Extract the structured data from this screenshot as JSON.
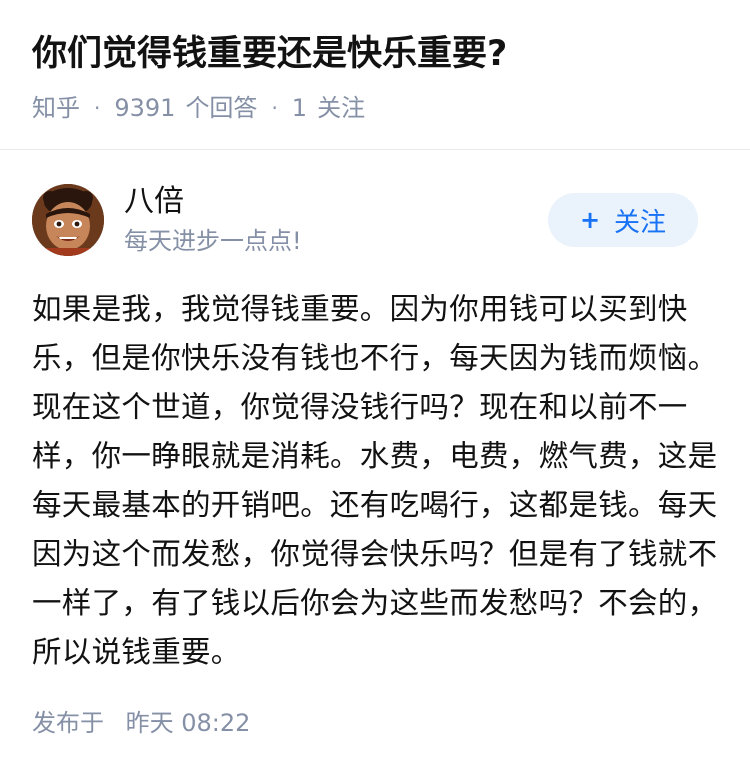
{
  "question": {
    "title": "你们觉得钱重要还是快乐重要?",
    "source": "知乎",
    "separator": "·",
    "answer_count": "9391",
    "answer_count_label": "个回答",
    "follow_count": "1",
    "follow_count_label": "关注"
  },
  "author": {
    "name": "八倍",
    "bio": "每天进步一点点!",
    "follow_button": {
      "icon": "plus-icon",
      "plus": "+",
      "label": "关注"
    }
  },
  "answer": {
    "content": "如果是我，我觉得钱重要。因为你用钱可以买到快乐，但是你快乐没有钱也不行，每天因为钱而烦恼。现在这个世道，你觉得没钱行吗？现在和以前不一样，你一睁眼就是消耗。水费，电费，燃气费，这是每天最基本的开销吧。还有吃喝行，这都是钱。每天因为这个而发愁，你觉得会快乐吗？但是有了钱就不一样了，有了钱以后你会为这些而发愁吗？不会的，所以说钱重要。"
  },
  "publish": {
    "label": "发布于",
    "time": "昨天 08:22"
  },
  "colors": {
    "text_primary": "#121212",
    "text_secondary": "#8590a6",
    "accent_blue": "#1772f6",
    "follow_bg": "#eaf2fb"
  }
}
